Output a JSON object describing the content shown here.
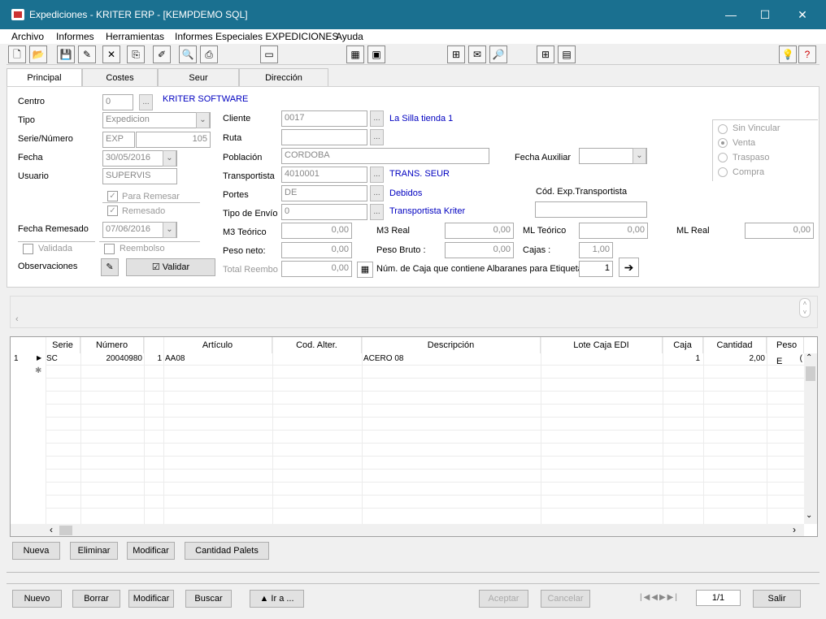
{
  "window": {
    "title": "Expediciones - KRITER ERP - [KEMPDEMO SQL]",
    "minimize": "—",
    "maximize": "☐",
    "close": "✕"
  },
  "menu": [
    "Archivo",
    "Informes",
    "Herramientas",
    "Informes Especiales EXPEDICIONES",
    "Ayuda"
  ],
  "tabs": [
    "Principal",
    "Costes",
    "Seur",
    "Dirección"
  ],
  "form": {
    "centro_label": "Centro",
    "centro_value": "0",
    "centro_name": "KRITER SOFTWARE",
    "tipo_label": "Tipo",
    "tipo_value": "Expedicion",
    "serie_label": "Serie/Número",
    "serie_value": "EXP",
    "numero_value": "105",
    "fecha_label": "Fecha",
    "fecha_value": "30/05/2016",
    "usuario_label": "Usuario",
    "usuario_value": "SUPERVIS",
    "para_remesar": "Para Remesar",
    "remesado": "Remesado",
    "fecha_remesado_label": "Fecha Remesado",
    "fecha_remesado_value": "07/06/2016",
    "validada": "Validada",
    "reembolso": "Reembolso",
    "observaciones_label": "Observaciones",
    "validar_button": "Validar",
    "cliente_label": "Cliente",
    "cliente_value": "0017",
    "cliente_name": "La Silla tienda 1",
    "ruta_label": "Ruta",
    "ruta_value": "",
    "poblacion_label": "Población",
    "poblacion_value": "CORDOBA",
    "transportista_label": "Transportista",
    "transportista_value": "4010001",
    "transportista_name": "TRANS. SEUR",
    "portes_label": "Portes",
    "portes_value": "DE",
    "portes_name": "Debidos",
    "tipo_envio_label": "Tipo de Envío",
    "tipo_envio_value": "0",
    "tipo_envio_name": "Transportista Kriter",
    "fecha_auxiliar_label": "Fecha Auxiliar",
    "cod_exp_label": "Cód. Exp.Transportista",
    "m3_teorico_label": "M3 Teórico",
    "m3_teorico_value": "0,00",
    "m3_real_label": "M3 Real",
    "m3_real_value": "0,00",
    "ml_teorico_label": "ML Teórico",
    "ml_teorico_value": "0,00",
    "ml_real_label": "ML Real",
    "ml_real_value": "0,00",
    "peso_neto_label": "Peso neto:",
    "peso_neto_value": "0,00",
    "peso_bruto_label": "Peso Bruto :",
    "peso_bruto_value": "0,00",
    "cajas_label": "Cajas :",
    "cajas_value": "1,00",
    "total_reemb_label": "Total Reembo",
    "total_reemb_value": "0,00",
    "num_caja_label": "Núm. de Caja que contiene Albaranes para Etiquetas",
    "num_caja_value": "1",
    "radio": [
      "Sin Vincular",
      "Venta",
      "Traspaso",
      "Compra"
    ]
  },
  "grid": {
    "columns": [
      "Serie",
      "Número",
      "Artículo",
      "Cod. Alter.",
      "Descripción",
      "Lote Caja EDI",
      "Caja",
      "Cantidad",
      "Peso E"
    ],
    "rows": [
      {
        "idx": "1",
        "serie": "SC",
        "numero": "20040980",
        "linea": "1",
        "articulo": "AA08",
        "cod_alter": "",
        "descripcion": "ACERO 08",
        "lote": "",
        "caja": "1",
        "cantidad": "2,00",
        "peso": "("
      }
    ],
    "new_row_marker": "✱"
  },
  "grid_buttons": [
    "Nueva",
    "Eliminar",
    "Modificar",
    "Cantidad Palets"
  ],
  "bottom_buttons": {
    "nuevo": "Nuevo",
    "borrar": "Borrar",
    "modificar": "Modificar",
    "buscar": "Buscar",
    "ira": "▲ Ir a ...",
    "aceptar": "Aceptar",
    "cancelar": "Cancelar",
    "record": "1/1",
    "salir": "Salir"
  }
}
